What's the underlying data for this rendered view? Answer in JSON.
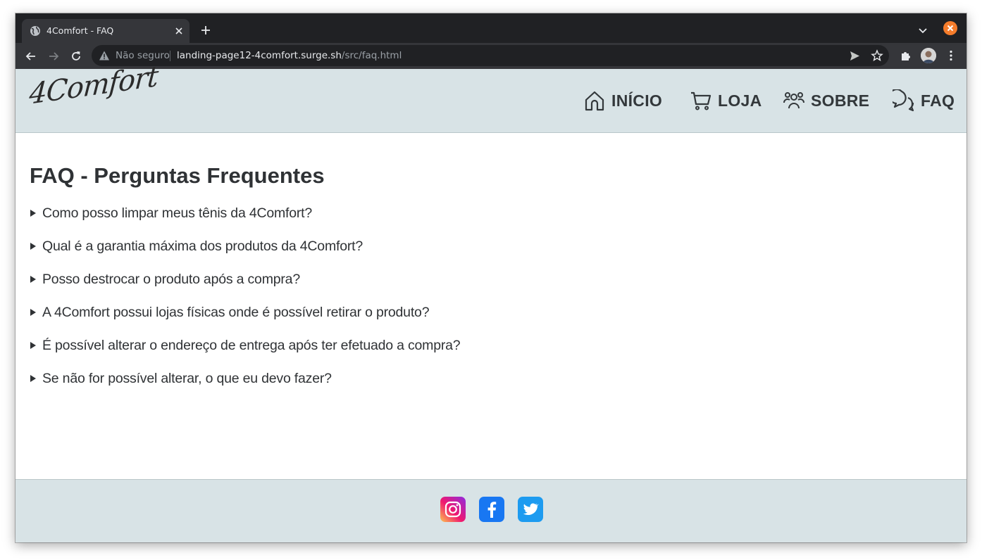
{
  "browser": {
    "tab_title": "4Comfort - FAQ",
    "security_label": "Não seguro",
    "url_host": "landing-page12-4comfort.surge.sh",
    "url_path": "/src/faq.html",
    "icons": [
      "globe-icon",
      "close-icon",
      "plus-icon",
      "chevron-down-icon",
      "back-arrow-icon",
      "forward-arrow-icon",
      "reload-icon",
      "warning-icon",
      "send-icon",
      "star-icon",
      "puzzle-icon",
      "kebab-menu-icon"
    ],
    "colors": {
      "tabstrip": "#202124",
      "toolbar": "#35363a",
      "window_close": "#f57c2b"
    }
  },
  "header": {
    "logo_text": "4Comfort",
    "nav": [
      {
        "label": "INÍCIO",
        "icon": "home-icon"
      },
      {
        "label": "LOJA",
        "icon": "cart-icon"
      },
      {
        "label": "SOBRE",
        "icon": "users-icon"
      },
      {
        "label": "FAQ",
        "icon": "chat-bubbles-icon"
      }
    ],
    "background": "#d8e3e6"
  },
  "main": {
    "title": "FAQ - Perguntas Frequentes",
    "questions": [
      "Como posso limpar meus tênis da 4Comfort?",
      "Qual é a garantia máxima dos produtos da 4Comfort?",
      "Posso destrocar o produto após a compra?",
      "A 4Comfort possui lojas físicas onde é possível retirar o produto?",
      "É possível alterar o endereço de entrega após ter efetuado a compra?",
      "Se não for possível alterar, o que eu devo fazer?"
    ]
  },
  "footer": {
    "social": [
      {
        "name": "Instagram",
        "icon": "instagram-icon"
      },
      {
        "name": "Facebook",
        "icon": "facebook-icon"
      },
      {
        "name": "Twitter",
        "icon": "twitter-icon"
      }
    ],
    "background": "#d8e3e6"
  }
}
